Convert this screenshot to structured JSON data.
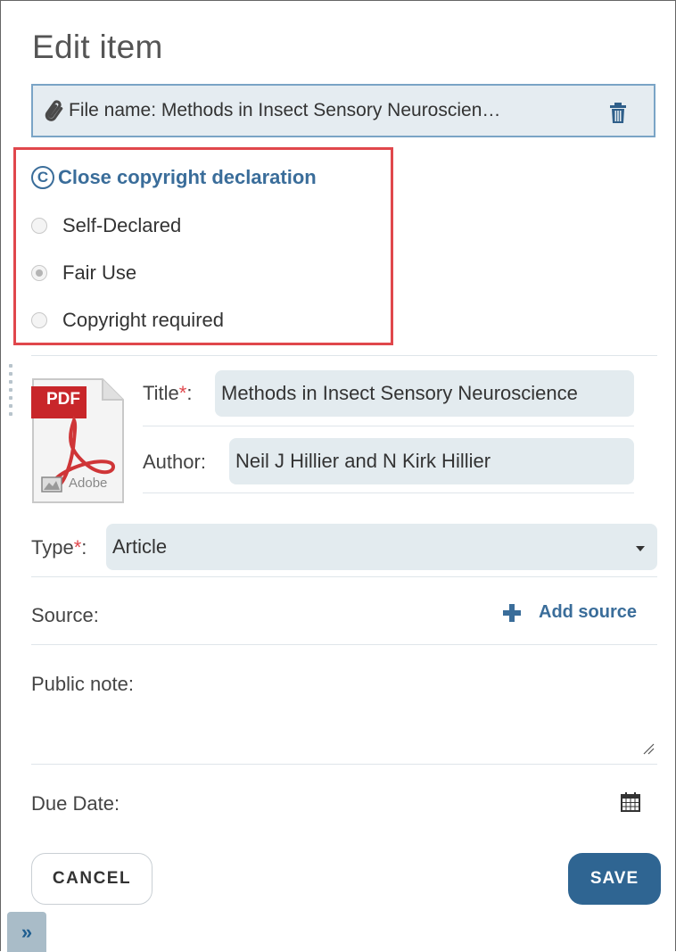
{
  "header": {
    "title": "Edit item"
  },
  "file": {
    "label": "File name: Methods in Insect Sensory Neuroscien…"
  },
  "copyright": {
    "toggle_label": "Close copyright declaration",
    "options": [
      {
        "label": "Self-Declared",
        "checked": false
      },
      {
        "label": "Fair Use",
        "checked": true
      },
      {
        "label": "Copyright required",
        "checked": false
      }
    ]
  },
  "thumbnail": {
    "badge": "PDF",
    "brand": "Adobe"
  },
  "fields": {
    "title_label": "Title",
    "title_value": "Methods in Insect Sensory Neuroscience",
    "author_label": "Author:",
    "author_value": "Neil J Hillier and N Kirk Hillier",
    "type_label": "Type",
    "type_value": "Article",
    "source_label": "Source:",
    "add_source_label": "Add source",
    "public_note_label": "Public note:",
    "public_note_value": "",
    "due_date_label": "Due Date:",
    "required_mark": "*",
    "colon": ":"
  },
  "actions": {
    "cancel_label": "CANCEL",
    "save_label": "SAVE",
    "expand_icon": "»"
  },
  "icons": [
    "paperclip-icon",
    "trash-icon",
    "copyright-icon",
    "pdf-file-icon",
    "plus-icon",
    "calendar-icon",
    "resize-grip-icon",
    "double-chevron-right-icon",
    "caret-down-icon"
  ],
  "colors": {
    "accent": "#3a6d9a",
    "save_button": "#2f6592",
    "highlight_border": "#e0474c",
    "field_bg": "#e3ebef",
    "required": "#e0474c"
  }
}
